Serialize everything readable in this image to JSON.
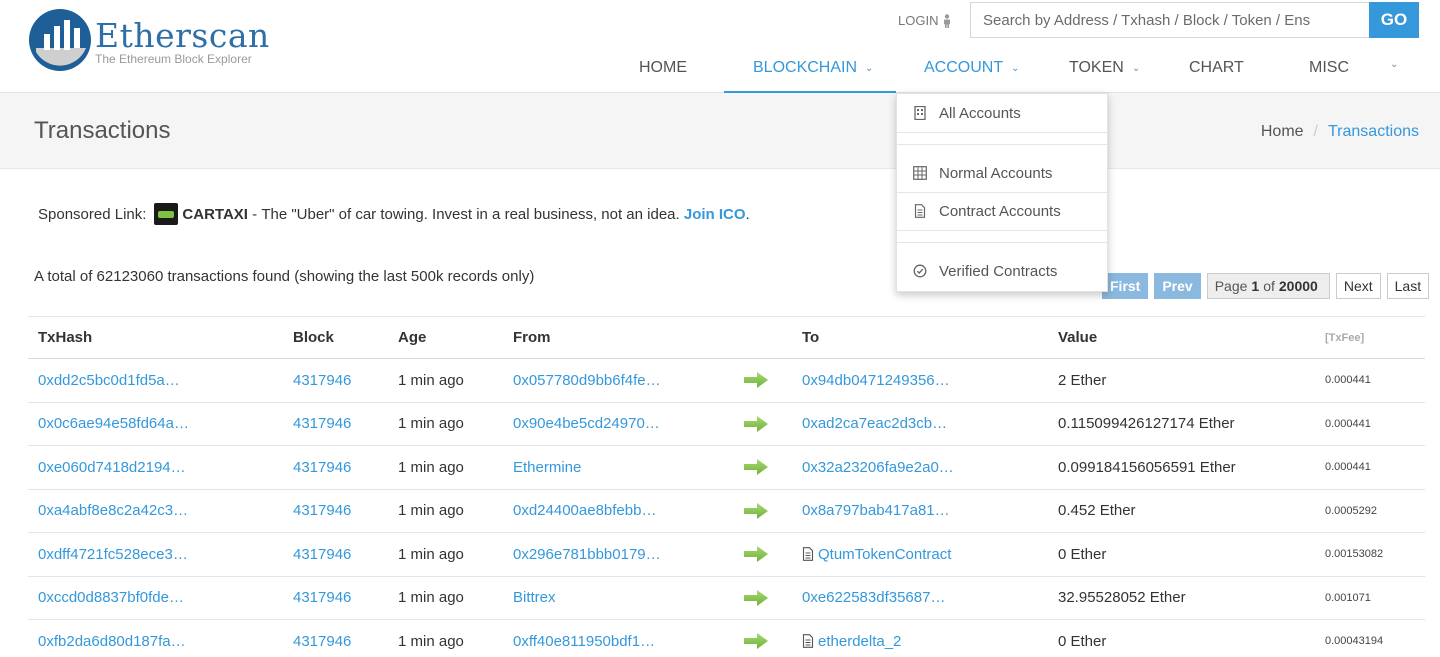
{
  "brand": {
    "name": "Etherscan",
    "tagline": "The Ethereum Block Explorer"
  },
  "header": {
    "login_label": "LOGIN",
    "search_placeholder": "Search by Address / Txhash / Block / Token / Ens",
    "go_label": "GO"
  },
  "nav": {
    "home": "HOME",
    "blockchain": "BLOCKCHAIN",
    "account": "ACCOUNT",
    "token": "TOKEN",
    "chart": "CHART",
    "misc": "MISC"
  },
  "account_menu": {
    "all": "All Accounts",
    "normal": "Normal Accounts",
    "contract": "Contract Accounts",
    "verified": "Verified Contracts"
  },
  "page": {
    "title": "Transactions",
    "breadcrumb_home": "Home",
    "breadcrumb_sep": "/",
    "breadcrumb_current": "Transactions"
  },
  "sponsored": {
    "label": "Sponsored Link:",
    "brand": "CARTAXI",
    "dash": " - ",
    "text": "The \"Uber\" of car towing. Invest in a real business, not an idea.",
    "cta": "Join ICO",
    "period": "."
  },
  "summary": "A total of 62123060 transactions found (showing the last 500k records only)",
  "pager": {
    "first": "First",
    "prev": "Prev",
    "page_prefix": "Page",
    "page_current": "1",
    "page_of": "of",
    "page_total": "20000",
    "next": "Next",
    "last": "Last"
  },
  "table": {
    "headers": {
      "hash": "TxHash",
      "block": "Block",
      "age": "Age",
      "from": "From",
      "to": "To",
      "value": "Value",
      "fee": "[TxFee]"
    },
    "rows": [
      {
        "hash": "0xdd2c5bc0d1fd5a…",
        "block": "4317946",
        "age": "1 min ago",
        "from": "0x057780d9bb6f4fe…",
        "to": "0x94db0471249356…",
        "to_contract": false,
        "value": "2 Ether",
        "fee": "0.000441"
      },
      {
        "hash": "0x0c6ae94e58fd64a…",
        "block": "4317946",
        "age": "1 min ago",
        "from": "0x90e4be5cd24970…",
        "to": "0xad2ca7eac2d3cb…",
        "to_contract": false,
        "value": "0.115099426127174 Ether",
        "fee": "0.000441"
      },
      {
        "hash": "0xe060d7418d2194…",
        "block": "4317946",
        "age": "1 min ago",
        "from": "Ethermine",
        "to": "0x32a23206fa9e2a0…",
        "to_contract": false,
        "value": "0.099184156056591 Ether",
        "fee": "0.000441"
      },
      {
        "hash": "0xa4abf8e8c2a42c3…",
        "block": "4317946",
        "age": "1 min ago",
        "from": "0xd24400ae8bfebb…",
        "to": "0x8a797bab417a81…",
        "to_contract": false,
        "value": "0.452 Ether",
        "fee": "0.0005292"
      },
      {
        "hash": "0xdff4721fc528ece3…",
        "block": "4317946",
        "age": "1 min ago",
        "from": "0x296e781bbb0179…",
        "to": "QtumTokenContract",
        "to_contract": true,
        "value": "0 Ether",
        "fee": "0.00153082"
      },
      {
        "hash": "0xccd0d8837bf0fde…",
        "block": "4317946",
        "age": "1 min ago",
        "from": "Bittrex",
        "to": "0xe622583df35687…",
        "to_contract": false,
        "value": "32.95528052 Ether",
        "fee": "0.001071"
      },
      {
        "hash": "0xfb2da6d80d187fa…",
        "block": "4317946",
        "age": "1 min ago",
        "from": "0xff40e811950bdf1…",
        "to": "etherdelta_2",
        "to_contract": true,
        "value": "0 Ether",
        "fee": "0.00043194"
      }
    ]
  },
  "colors": {
    "accent": "#3498db",
    "arrow": "#7dc242",
    "pager_disabled": "#8bb8de"
  }
}
